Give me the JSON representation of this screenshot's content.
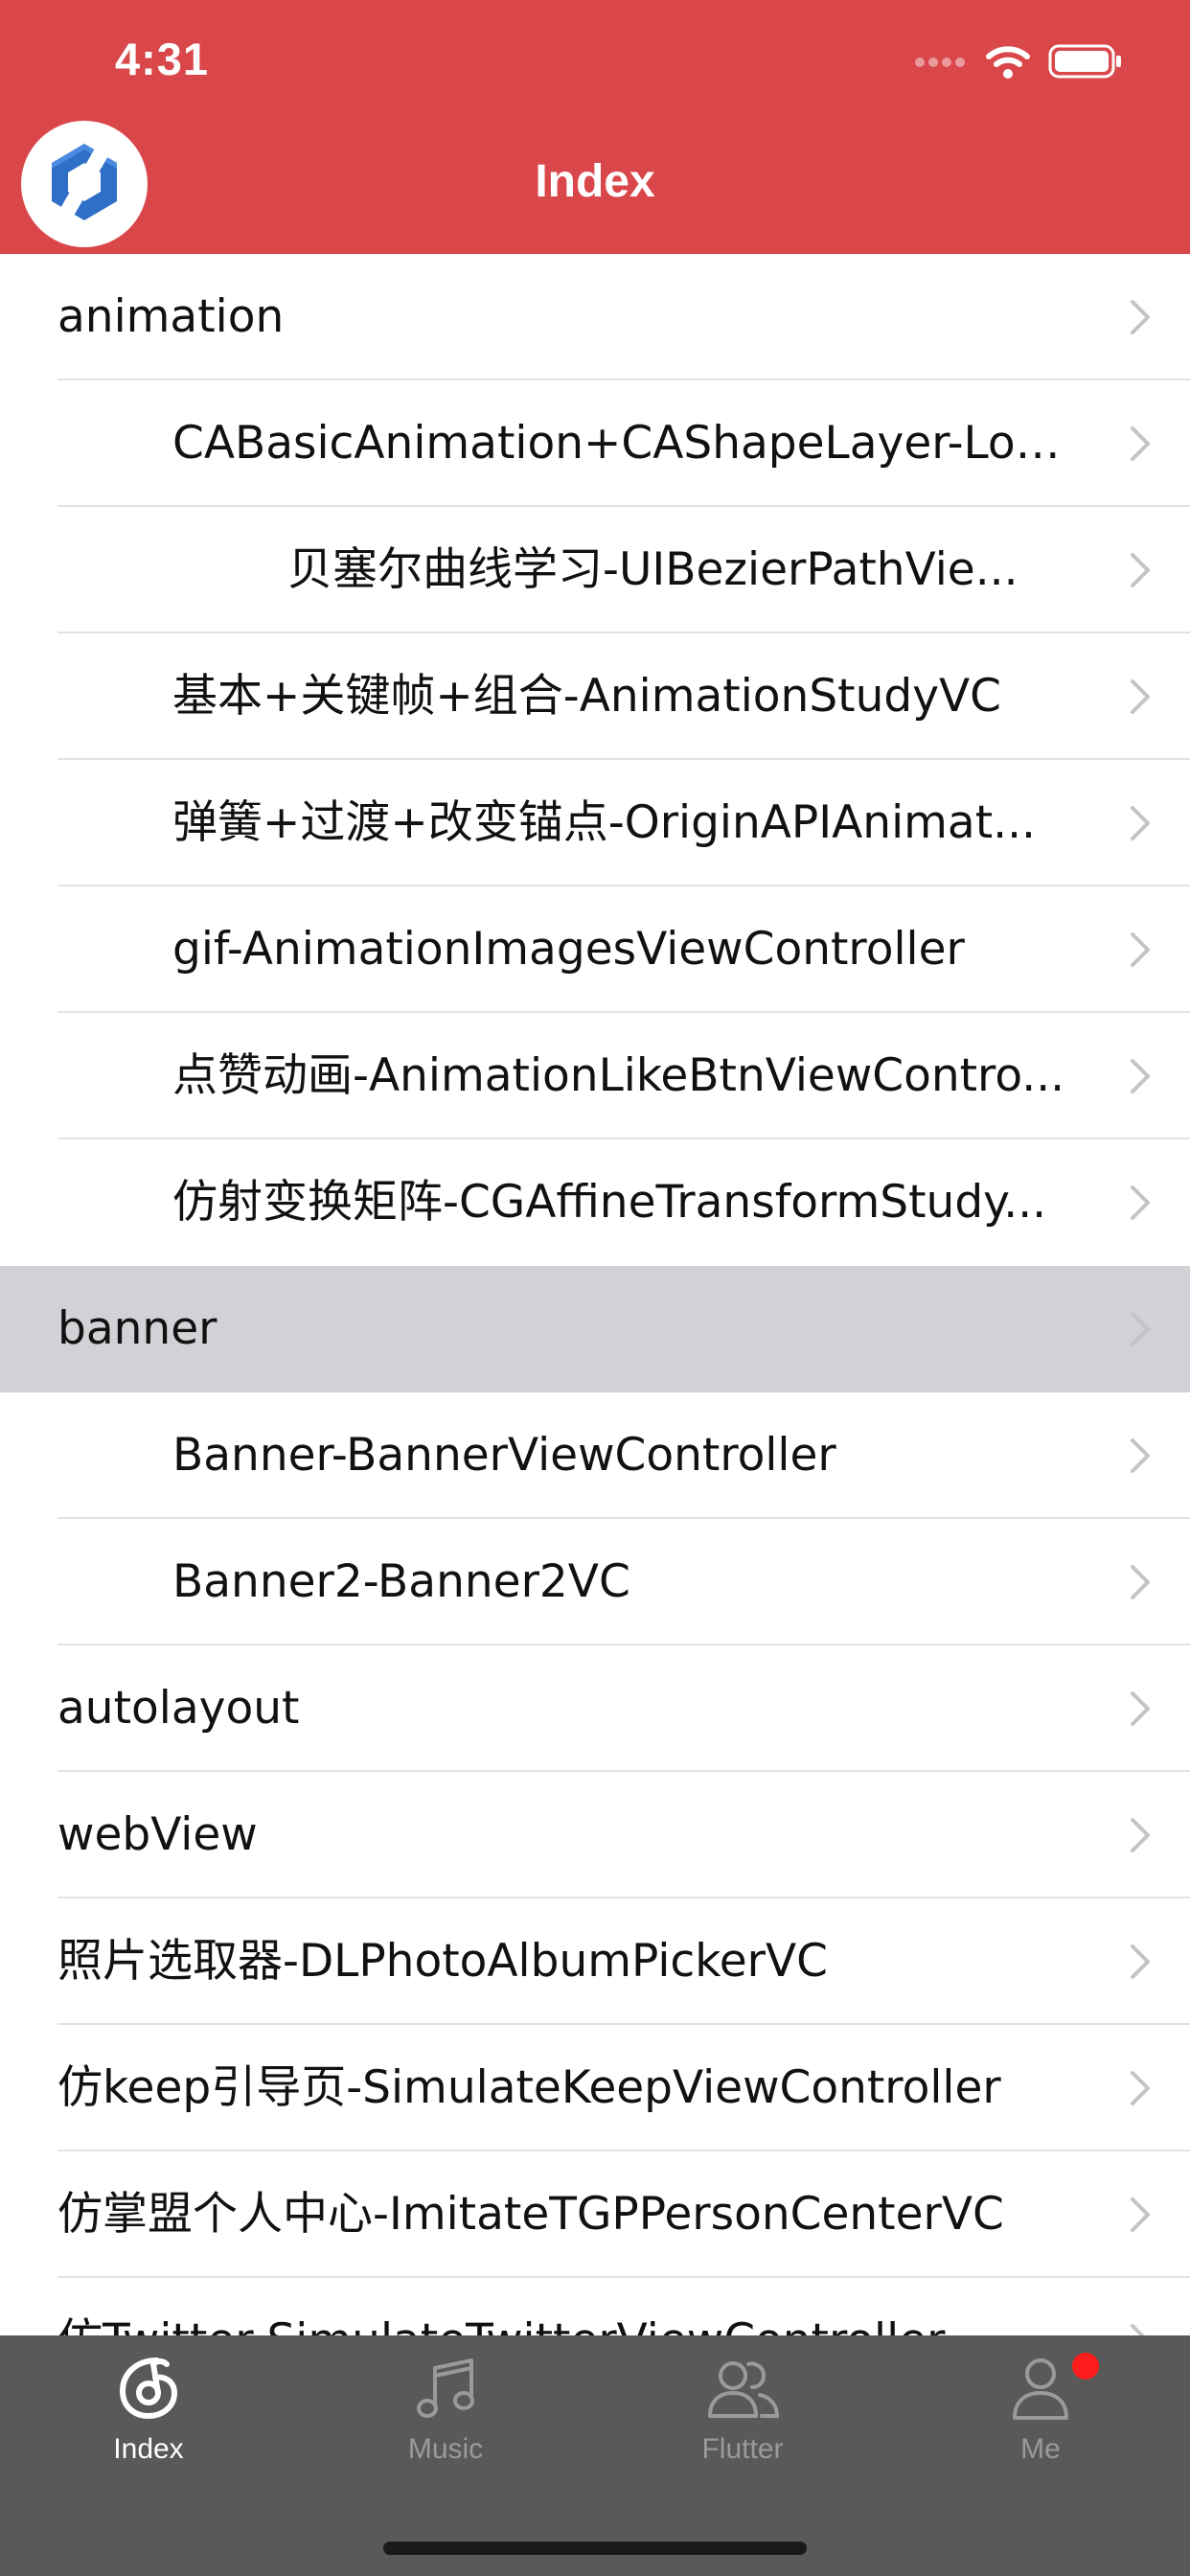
{
  "status_bar": {
    "time": "4:31",
    "icons": [
      "signal-icon",
      "wifi-icon",
      "battery-icon"
    ]
  },
  "nav_bar": {
    "title": "Index",
    "avatar_icon": "hexagon-logo-icon"
  },
  "list": {
    "rows": [
      {
        "label": "animation",
        "indent": 0,
        "selected": false
      },
      {
        "label": "CABasicAnimation+CAShapeLayer-Loa...",
        "indent": 1,
        "selected": false
      },
      {
        "label": "贝塞尔曲线学习-UIBezierPathVie...",
        "indent": 2,
        "selected": false
      },
      {
        "label": "基本+关键帧+组合-AnimationStudyVC",
        "indent": 1,
        "selected": false
      },
      {
        "label": "弹簧+过渡+改变锚点-OriginAPIAnimat...",
        "indent": 1,
        "selected": false
      },
      {
        "label": "gif-AnimationImagesViewController",
        "indent": 1,
        "selected": false
      },
      {
        "label": "点赞动画-AnimationLikeBtnViewContro...",
        "indent": 1,
        "selected": false
      },
      {
        "label": "仿射变换矩阵-CGAffineTransformStudy...",
        "indent": 1,
        "selected": false
      },
      {
        "label": "banner",
        "indent": 0,
        "selected": true
      },
      {
        "label": "Banner-BannerViewController",
        "indent": 1,
        "selected": false
      },
      {
        "label": "Banner2-Banner2VC",
        "indent": 1,
        "selected": false
      },
      {
        "label": "autolayout",
        "indent": 0,
        "selected": false
      },
      {
        "label": "webView",
        "indent": 0,
        "selected": false
      },
      {
        "label": "照片选取器-DLPhotoAlbumPickerVC",
        "indent": 0,
        "selected": false
      },
      {
        "label": "仿keep引导页-SimulateKeepViewController",
        "indent": 0,
        "selected": false
      },
      {
        "label": "仿掌盟个人中心-ImitateTGPPersonCenterVC",
        "indent": 0,
        "selected": false
      },
      {
        "label": "仿Twitter-SimulateTwitterViewController",
        "indent": 0,
        "selected": false
      }
    ],
    "chevron_icon": "chevron-right-icon"
  },
  "tab_bar": {
    "tabs": [
      {
        "label": "Index",
        "icon": "music-note-circle-icon",
        "active": true,
        "badge": false
      },
      {
        "label": "Music",
        "icon": "music-notes-icon",
        "active": false,
        "badge": false
      },
      {
        "label": "Flutter",
        "icon": "people-icon",
        "active": false,
        "badge": false
      },
      {
        "label": "Me",
        "icon": "person-icon",
        "active": false,
        "badge": true
      }
    ]
  },
  "colors": {
    "brand_red": "#d9474a",
    "tab_bar_bg": "#595959",
    "tab_active": "#ffffff",
    "tab_inactive": "#9a9a9a",
    "selected_row": "#d1d1d6",
    "badge_red": "#ff1c1c"
  }
}
